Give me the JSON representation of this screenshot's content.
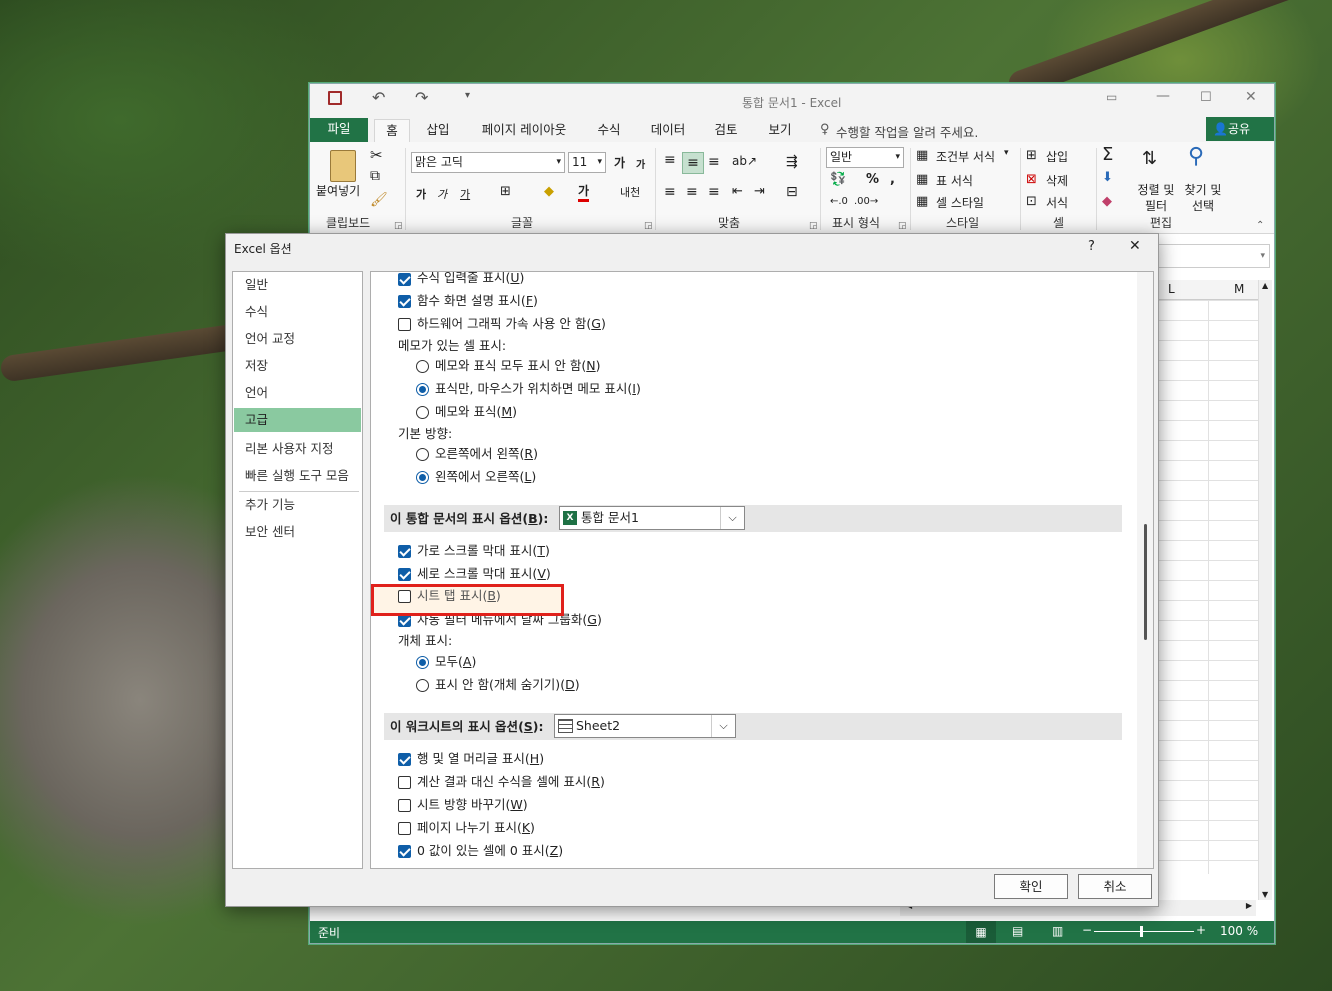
{
  "excel": {
    "title": "통합 문서1 - Excel",
    "tabs": [
      "파일",
      "홈",
      "삽입",
      "페이지 레이아웃",
      "수식",
      "데이터",
      "검토",
      "보기"
    ],
    "tell_me": "수행할 작업을 알려 주세요.",
    "share": "공유",
    "ribbon": {
      "paste": "붙여넣기",
      "clipboard": "클립보드",
      "font_name": "맑은 고딕",
      "font_size": "11",
      "font_group": "글꼴",
      "align_group": "맞춤",
      "number_format": "일반",
      "number_group": "표시 형식",
      "cond_format": "조건부 서식",
      "table_format": "표 서식",
      "cell_style": "셀 스타일",
      "style_group": "스타일",
      "insert": "삽입",
      "delete": "삭제",
      "format": "서식",
      "cells_group": "셀",
      "sort_filter": "정렬 및 필터",
      "find_select": "찾기 및 선택",
      "edit_group": "편집"
    },
    "columns": [
      "L",
      "M"
    ],
    "status": "준비",
    "zoom": "100 %"
  },
  "dialog": {
    "title": "Excel 옵션",
    "help": "?",
    "close": "✕",
    "nav": [
      "일반",
      "수식",
      "언어 교정",
      "저장",
      "언어",
      "고급",
      "리본 사용자 지정",
      "빠른 실행 도구 모음",
      "추가 기능",
      "보안 센터"
    ],
    "opts": {
      "formula_bar": {
        "text": "수식 입력줄 표시",
        "key": "U",
        "suffix": ""
      },
      "func_tips": {
        "text": "함수 화면 설명 표시",
        "key": "F",
        "suffix": ""
      },
      "hw_accel": {
        "text": "하드웨어 그래픽 가속 사용 안 함",
        "key": "G",
        "suffix": ""
      },
      "comments_label": "메모가 있는 셀 표시:",
      "no_comments": {
        "text": "메모와 표식 모두 표시 안 함",
        "key": "N",
        "suffix": ""
      },
      "indicators_only": {
        "text": "표식만, 마우스가 위치하면 메모 표시",
        "key": "I",
        "suffix": ""
      },
      "comments_and_ind": {
        "text": "메모와 표식",
        "key": "M",
        "suffix": ""
      },
      "direction_label": "기본 방향:",
      "rtl": {
        "text": "오른쪽에서 왼쪽",
        "key": "R",
        "suffix": ""
      },
      "ltr": {
        "text": "왼쪽에서 오른쪽",
        "key": "L",
        "suffix": ""
      },
      "wb_section": {
        "text": "이 통합 문서의 표시 옵션",
        "key": "B",
        "suffix": ":"
      },
      "wb_select": "통합 문서1",
      "hscroll": {
        "text": "가로 스크롤 막대 표시",
        "key": "T",
        "suffix": ""
      },
      "vscroll": {
        "text": "세로 스크롤 막대 표시",
        "key": "V",
        "suffix": ""
      },
      "sheet_tabs": {
        "text": "시트 탭 표시",
        "key": "B",
        "suffix": ""
      },
      "group_dates": {
        "text": "자동 필터 메뉴에서 날짜 그룹화",
        "key": "G",
        "suffix": ""
      },
      "objects_label": "개체 표시:",
      "obj_all": {
        "text": "모두",
        "key": "A",
        "suffix": ""
      },
      "obj_none": {
        "text": "표시 안 함(개체 숨기기)",
        "key": "D",
        "suffix": ""
      },
      "ws_section": {
        "text": "이 워크시트의 표시 옵션",
        "key": "S",
        "suffix": ":"
      },
      "ws_select": "Sheet2",
      "headers": {
        "text": "행 및 열 머리글 표시",
        "key": "H",
        "suffix": ""
      },
      "formulas": {
        "text": "계산 결과 대신 수식을 셀에 표시",
        "key": "R",
        "suffix": ""
      },
      "rtl_sheet": {
        "text": "시트 방향 바꾸기",
        "key": "W",
        "suffix": ""
      },
      "page_breaks": {
        "text": "페이지 나누기 표시",
        "key": "K",
        "suffix": ""
      },
      "zeros": {
        "text": "0 값이 있는 셀에 0 표시",
        "key": "Z",
        "suffix": ""
      }
    },
    "ok": "확인",
    "cancel": "취소"
  }
}
